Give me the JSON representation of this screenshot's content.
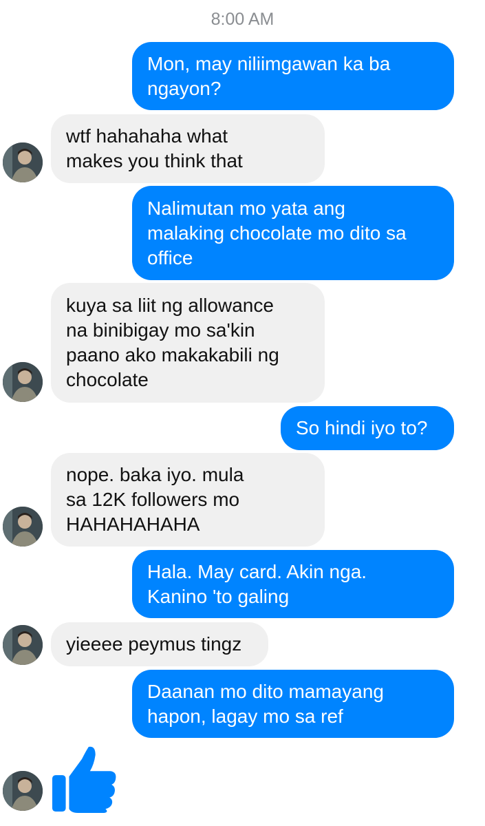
{
  "chat": {
    "timestamp": "8:00 AM",
    "messages": [
      {
        "sender": "me",
        "text": "Mon, may niliimgawan ka ba\nngayon?"
      },
      {
        "sender": "them",
        "text": "wtf hahahaha what\nmakes you think that"
      },
      {
        "sender": "me",
        "text": "Nalimutan mo yata ang\nmalaking chocolate mo dito sa\noffice"
      },
      {
        "sender": "them",
        "text": "kuya sa liit ng allowance\nna binibigay mo sa'kin\npaano ako makakabili ng\nchocolate"
      },
      {
        "sender": "me",
        "text": "So hindi iyo to?"
      },
      {
        "sender": "them",
        "text": "nope. baka iyo. mula\nsa 12K followers mo\nHAHAHAHAHA"
      },
      {
        "sender": "me",
        "text": "Hala. May card. Akin nga.\nKanino 'to galing"
      },
      {
        "sender": "them",
        "text": "yieeee peymus tingz"
      },
      {
        "sender": "me",
        "text": "Daanan mo dito mamayang\nhapon, lagay mo sa ref"
      }
    ],
    "last_reaction": "thumbs-up-icon"
  },
  "colors": {
    "outgoing_bubble": "#0084ff",
    "incoming_bubble": "#f0f0f0",
    "timestamp_text": "#8a8d91",
    "like_icon": "#0084ff"
  }
}
